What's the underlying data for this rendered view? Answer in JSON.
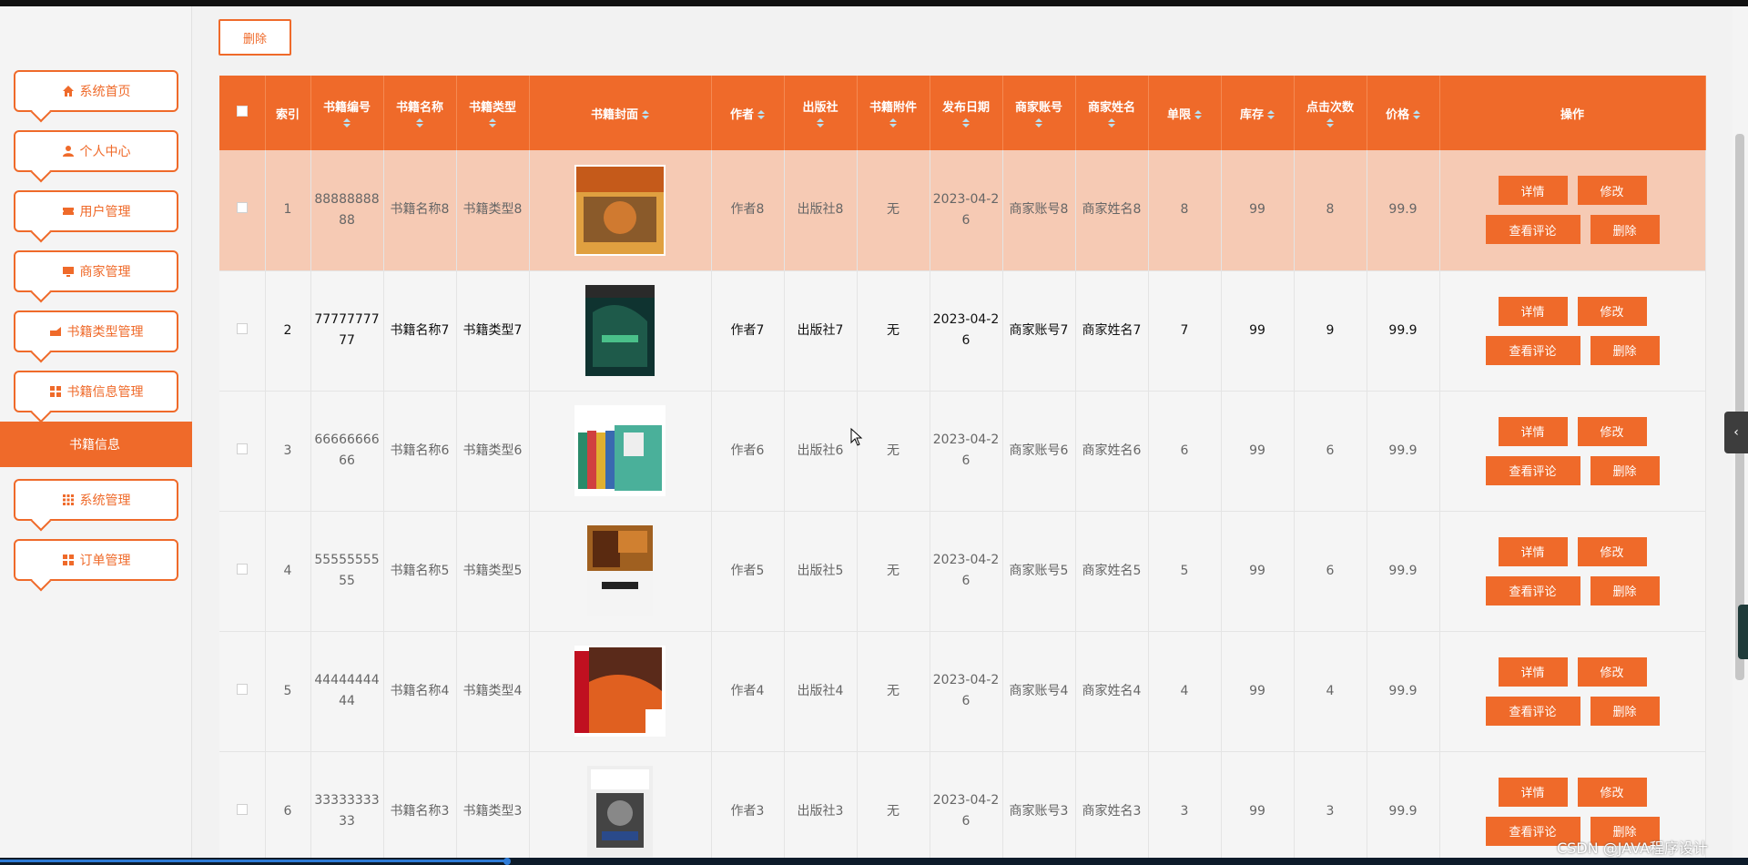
{
  "sidebar": {
    "items": [
      {
        "label": "系统首页",
        "icon": "home-icon"
      },
      {
        "label": "个人中心",
        "icon": "user-icon"
      },
      {
        "label": "用户管理",
        "icon": "ticket-icon"
      },
      {
        "label": "商家管理",
        "icon": "monitor-icon"
      },
      {
        "label": "书籍类型管理",
        "icon": "tag-icon"
      },
      {
        "label": "书籍信息管理",
        "icon": "grid-icon"
      },
      {
        "label": "系统管理",
        "icon": "apps-icon"
      },
      {
        "label": "订单管理",
        "icon": "grid-icon"
      }
    ],
    "active_sub": "书籍信息"
  },
  "toolbar": {
    "delete_label": "删除"
  },
  "table": {
    "headers": [
      "索引",
      "书籍编号",
      "书籍名称",
      "书籍类型",
      "书籍封面",
      "作者",
      "出版社",
      "书籍附件",
      "发布日期",
      "商家账号",
      "商家姓名",
      "单限",
      "库存",
      "点击次数",
      "价格",
      "操作"
    ],
    "rows": [
      {
        "index": "1",
        "code": "8888888888",
        "name": "书籍名称8",
        "type": "书籍类型8",
        "cover": "book-cover-8",
        "author": "作者8",
        "publisher": "出版社8",
        "attachment": "无",
        "date": "2023-04-26",
        "merchant_account": "商家账号8",
        "merchant_name": "商家姓名8",
        "limit": "8",
        "stock": "99",
        "clicks": "8",
        "price": "99.9"
      },
      {
        "index": "2",
        "code": "7777777777",
        "name": "书籍名称7",
        "type": "书籍类型7",
        "cover": "book-cover-7",
        "author": "作者7",
        "publisher": "出版社7",
        "attachment": "无",
        "date": "2023-04-26",
        "merchant_account": "商家账号7",
        "merchant_name": "商家姓名7",
        "limit": "7",
        "stock": "99",
        "clicks": "9",
        "price": "99.9"
      },
      {
        "index": "3",
        "code": "6666666666",
        "name": "书籍名称6",
        "type": "书籍类型6",
        "cover": "book-cover-6",
        "author": "作者6",
        "publisher": "出版社6",
        "attachment": "无",
        "date": "2023-04-26",
        "merchant_account": "商家账号6",
        "merchant_name": "商家姓名6",
        "limit": "6",
        "stock": "99",
        "clicks": "6",
        "price": "99.9"
      },
      {
        "index": "4",
        "code": "5555555555",
        "name": "书籍名称5",
        "type": "书籍类型5",
        "cover": "book-cover-5",
        "author": "作者5",
        "publisher": "出版社5",
        "attachment": "无",
        "date": "2023-04-26",
        "merchant_account": "商家账号5",
        "merchant_name": "商家姓名5",
        "limit": "5",
        "stock": "99",
        "clicks": "6",
        "price": "99.9"
      },
      {
        "index": "5",
        "code": "4444444444",
        "name": "书籍名称4",
        "type": "书籍类型4",
        "cover": "book-cover-4",
        "author": "作者4",
        "publisher": "出版社4",
        "attachment": "无",
        "date": "2023-04-26",
        "merchant_account": "商家账号4",
        "merchant_name": "商家姓名4",
        "limit": "4",
        "stock": "99",
        "clicks": "4",
        "price": "99.9"
      },
      {
        "index": "6",
        "code": "3333333333",
        "name": "书籍名称3",
        "type": "书籍类型3",
        "cover": "book-cover-3",
        "author": "作者3",
        "publisher": "出版社3",
        "attachment": "无",
        "date": "2023-04-26",
        "merchant_account": "商家账号3",
        "merchant_name": "商家姓名3",
        "limit": "3",
        "stock": "99",
        "clicks": "3",
        "price": "99.9"
      }
    ],
    "actions": {
      "detail": "详情",
      "edit": "修改",
      "comments": "查看评论",
      "delete": "删除"
    }
  },
  "watermark": "CSDN @JAVA程序设计",
  "colors": {
    "accent": "#ef6a2a",
    "highlight_row": "#f6cab4",
    "row_bg": "#f5f5f5"
  }
}
